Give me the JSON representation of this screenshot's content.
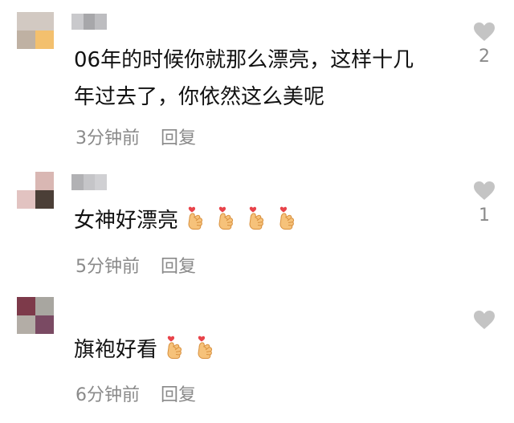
{
  "comments": [
    {
      "avatar_colors": [
        "#d2c9c2",
        "#d2c9c2",
        "#bfb1a3",
        "#f3c06e"
      ],
      "username_colors": [
        "#c9c9cc",
        "#a7a7aa",
        "#bdbdc0"
      ],
      "lines": [
        "06年的时候你就那么漂亮，这样十几",
        "年过去了，你依然这么美呢"
      ],
      "time": "3分钟前",
      "reply_label": "回复",
      "like_count": "2",
      "emoji_count": 0
    },
    {
      "avatar_colors": [
        "#ffffff",
        "#d9b7b3",
        "#e2c3c1",
        "#4b3f37"
      ],
      "username_colors": [
        "#b1b1b4",
        "#c5c5c8",
        "#d0d0d3"
      ],
      "lines": [
        "女神好漂亮"
      ],
      "time": "5分钟前",
      "reply_label": "回复",
      "like_count": "1",
      "emoji_count": 4,
      "emoji_icon": "finger-heart"
    },
    {
      "avatar_colors": [
        "#7d3a4a",
        "#a8a6a0",
        "#b3ada6",
        "#7a4a63"
      ],
      "username_colors": [],
      "lines": [
        "旗袍好看"
      ],
      "time": "6分钟前",
      "reply_label": "回复",
      "like_count": "",
      "emoji_count": 2,
      "emoji_icon": "finger-heart"
    }
  ],
  "colors": {
    "text": "#111111",
    "meta": "#8a8a8a",
    "heart": "#c4c4c4"
  }
}
